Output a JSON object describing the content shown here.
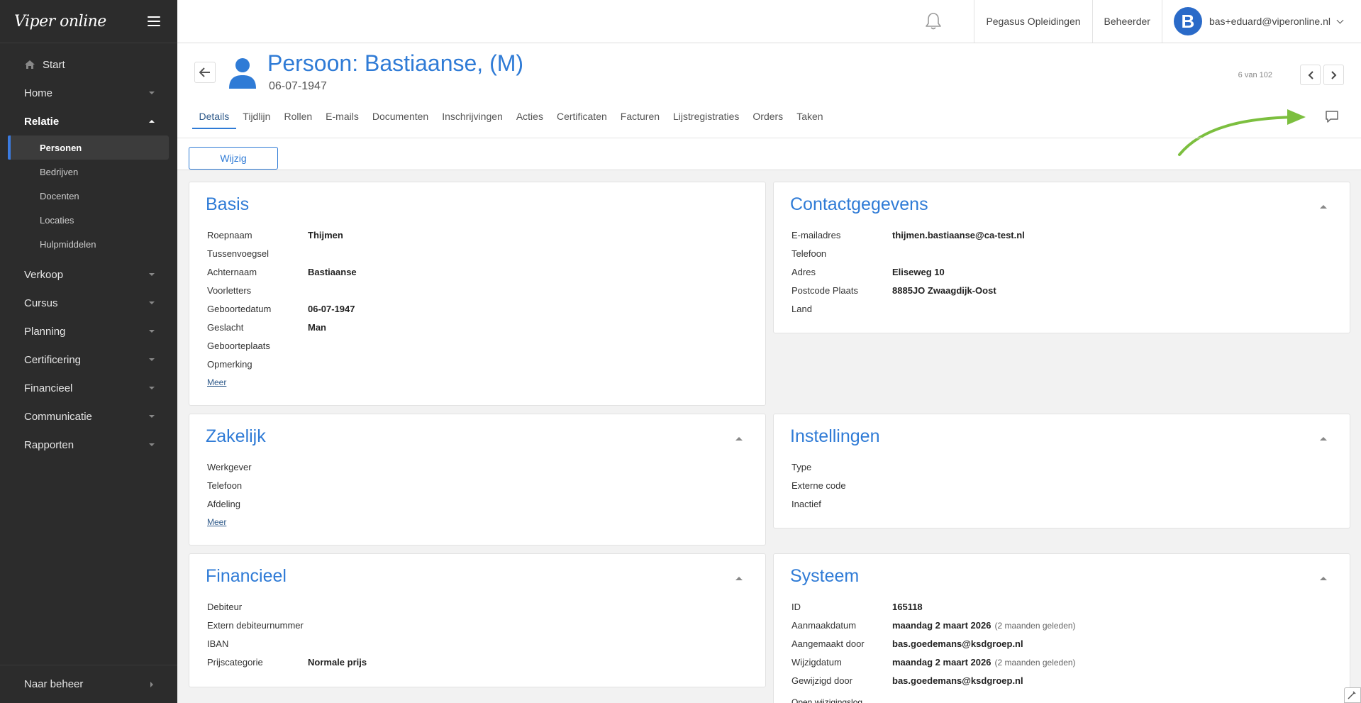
{
  "sidebar": {
    "logo": "Viper online",
    "start": "Start",
    "items": [
      {
        "label": "Home"
      },
      {
        "label": "Relatie"
      },
      {
        "label": "Verkoop"
      },
      {
        "label": "Cursus"
      },
      {
        "label": "Planning"
      },
      {
        "label": "Certificering"
      },
      {
        "label": "Financieel"
      },
      {
        "label": "Communicatie"
      },
      {
        "label": "Rapporten"
      }
    ],
    "relatie_sub": [
      {
        "label": "Personen"
      },
      {
        "label": "Bedrijven"
      },
      {
        "label": "Docenten"
      },
      {
        "label": "Locaties"
      },
      {
        "label": "Hulpmiddelen"
      }
    ],
    "footer": "Naar beheer"
  },
  "topbar": {
    "org": "Pegasus Opleidingen",
    "role": "Beheerder",
    "avatar_letter": "B",
    "user": "bas+eduard@viperonline.nl"
  },
  "header": {
    "title": "Persoon: Bastiaanse, (M)",
    "subtitle": "06-07-1947",
    "pager": "6 van 102",
    "tabs": [
      "Details",
      "Tijdlijn",
      "Rollen",
      "E-mails",
      "Documenten",
      "Inschrijvingen",
      "Acties",
      "Certificaten",
      "Facturen",
      "Lijstregistraties",
      "Orders",
      "Taken"
    ],
    "edit_label": "Wijzig"
  },
  "cards": {
    "basis": {
      "title": "Basis",
      "rows": [
        {
          "label": "Roepnaam",
          "value": "Thijmen"
        },
        {
          "label": "Tussenvoegsel",
          "value": ""
        },
        {
          "label": "Achternaam",
          "value": "Bastiaanse"
        },
        {
          "label": "Voorletters",
          "value": ""
        },
        {
          "label": "Geboortedatum",
          "value": "06-07-1947"
        },
        {
          "label": "Geslacht",
          "value": "Man"
        },
        {
          "label": "Geboorteplaats",
          "value": ""
        },
        {
          "label": "Opmerking",
          "value": ""
        }
      ],
      "more": "Meer"
    },
    "contact": {
      "title": "Contactgegevens",
      "rows": [
        {
          "label": "E-mailadres",
          "value": "thijmen.bastiaanse@ca-test.nl"
        },
        {
          "label": "Telefoon",
          "value": ""
        },
        {
          "label": "Adres",
          "value": "Eliseweg 10"
        },
        {
          "label": "Postcode Plaats",
          "value": "8885JO Zwaagdijk-Oost"
        },
        {
          "label": "Land",
          "value": ""
        }
      ]
    },
    "zakelijk": {
      "title": "Zakelijk",
      "rows": [
        {
          "label": "Werkgever",
          "value": ""
        },
        {
          "label": "Telefoon",
          "value": ""
        },
        {
          "label": "Afdeling",
          "value": ""
        }
      ],
      "more": "Meer"
    },
    "instellingen": {
      "title": "Instellingen",
      "rows": [
        {
          "label": "Type",
          "value": ""
        },
        {
          "label": "Externe code",
          "value": ""
        },
        {
          "label": "Inactief",
          "value": ""
        }
      ]
    },
    "financieel": {
      "title": "Financieel",
      "rows": [
        {
          "label": "Debiteur",
          "value": ""
        },
        {
          "label": "Extern debiteurnummer",
          "value": ""
        },
        {
          "label": "IBAN",
          "value": ""
        },
        {
          "label": "Prijscategorie",
          "value": "Normale prijs"
        }
      ]
    },
    "systeem": {
      "title": "Systeem",
      "rows": [
        {
          "label": "ID",
          "value": "165118",
          "note": ""
        },
        {
          "label": "Aanmaakdatum",
          "value": "maandag 2 maart 2026",
          "note": "(2 maanden geleden)"
        },
        {
          "label": "Aangemaakt door",
          "value": "bas.goedemans@ksdgroep.nl",
          "note": ""
        },
        {
          "label": "Wijzigdatum",
          "value": "maandag 2 maart 2026",
          "note": "(2 maanden geleden)"
        },
        {
          "label": "Gewijzigd door",
          "value": "bas.goedemans@ksdgroep.nl",
          "note": ""
        }
      ],
      "log": "Open wijzigingslog"
    }
  },
  "colors": {
    "accent": "#2f7bd6",
    "sidebar": "#2c2c2c",
    "annotation_arrow": "#7cbf3f"
  }
}
